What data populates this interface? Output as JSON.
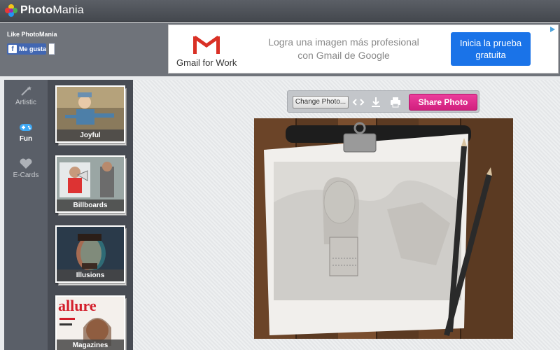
{
  "header": {
    "logo_text_bold": "Photo",
    "logo_text": "Mania"
  },
  "like": {
    "label": "Like PhotoMania",
    "fb_button": "Me gusta",
    "fb_letter": "f"
  },
  "ad": {
    "brand": "Gmail for Work",
    "headline_line1": "Logra una imagen más profesional",
    "headline_line2": "con Gmail de Google",
    "cta_line1": "Inicia la prueba",
    "cta_line2": "gratuita",
    "close_icon": "adchoices-icon"
  },
  "nav": {
    "items": [
      {
        "label": "Artistic",
        "icon": "magic-wand-icon"
      },
      {
        "label": "Fun",
        "icon": "gamepad-icon",
        "active": true
      },
      {
        "label": "E-Cards",
        "icon": "heart-icon"
      }
    ]
  },
  "thumbnails": [
    {
      "caption": "Joyful"
    },
    {
      "caption": "Billboards"
    },
    {
      "caption": "Illusions"
    },
    {
      "caption": "Magazines",
      "cover_text": "allure"
    }
  ],
  "toolbar": {
    "change_photo": "Change Photo...",
    "share_photo": "Share Photo",
    "icons": [
      "embed-icon",
      "download-icon",
      "print-icon"
    ]
  },
  "colors": {
    "share_button": "#e0338f",
    "accent_blue": "#1a73e8",
    "gmail_red": "#d93025"
  }
}
